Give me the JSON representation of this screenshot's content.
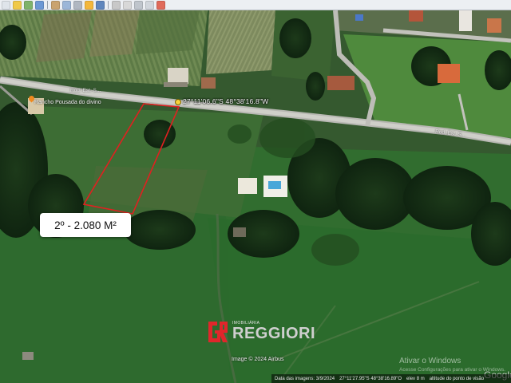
{
  "toolbar": {
    "buttons": [
      {
        "icon": "hand-icon",
        "color": "#dfe4ea"
      },
      {
        "icon": "placemark-icon",
        "color": "#f0c94a"
      },
      {
        "icon": "polygon-icon",
        "color": "#7fb36b"
      },
      {
        "icon": "path-icon",
        "color": "#6c98d4"
      },
      {
        "icon": "overlay-icon",
        "color": "#c9a36f"
      },
      {
        "icon": "tour-icon",
        "color": "#9bb6d8"
      },
      {
        "icon": "history-icon",
        "color": "#b0b7c1"
      },
      {
        "icon": "sun-icon",
        "color": "#f3b73b"
      },
      {
        "icon": "planet-icon",
        "color": "#5f86bd"
      },
      {
        "icon": "ruler-icon",
        "color": "#c8c8c8"
      },
      {
        "icon": "email-icon",
        "color": "#d8d8d8"
      },
      {
        "icon": "print-icon",
        "color": "#bfc5cc"
      },
      {
        "icon": "save-image-icon",
        "color": "#d1d6dc"
      },
      {
        "icon": "maps-icon",
        "color": "#e06a5a"
      }
    ]
  },
  "map": {
    "coordinate_label": "27°11'06.6\"S 48°38'16.8\"W",
    "place_label": "Rancho Pousada do divino",
    "road_labels": [
      "Rod. Est. S...",
      "Rod. Est. S..."
    ],
    "area_label": "2º - 2.080 M²",
    "highlight_color": "#e02020"
  },
  "watermark": {
    "small_text": "IMOBILIÁRIA",
    "name": "REGGIORI",
    "logo_color": "#e0262b"
  },
  "credit": "Image © 2024 Airbus",
  "windows_activation": {
    "title": "Ativar o Windows",
    "subtitle": "Acesse Configurações para ativar o Windows."
  },
  "google_logo": "Google",
  "status": {
    "imagery_date": "Data das imagens: 3/9/2024",
    "coordinates": "27°11'27.95\"S  48°38'16.89\"O",
    "elevation": "elev   8 m",
    "eye_altitude": "altitude do ponto de visão"
  }
}
